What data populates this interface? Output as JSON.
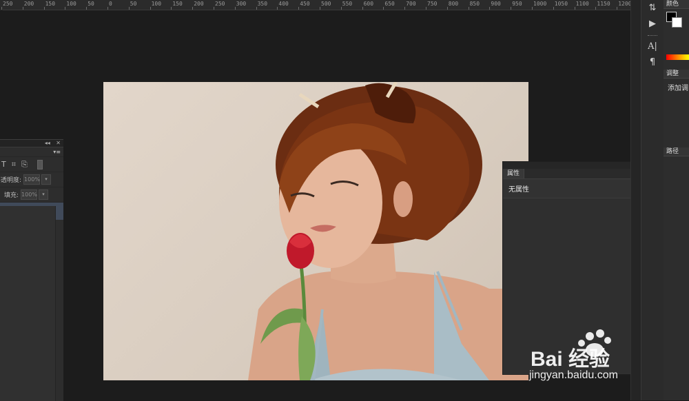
{
  "ruler": {
    "ticks": [
      "250",
      "200",
      "150",
      "100",
      "50",
      "0",
      "50",
      "100",
      "150",
      "200",
      "250",
      "300",
      "350",
      "400",
      "450",
      "500",
      "550",
      "600",
      "650",
      "700",
      "750",
      "800",
      "850",
      "900",
      "950",
      "1000",
      "1050",
      "1100",
      "1150",
      "1200"
    ]
  },
  "layers_panel": {
    "opacity_label": "不透明度:",
    "opacity_value": "100%",
    "fill_label": "填充:",
    "fill_value": "100%"
  },
  "properties_panel": {
    "tab_label": "属性",
    "body_text": "无属性"
  },
  "right_panels": {
    "color_tab": "颜色",
    "adjust_tab": "调整",
    "add_adjust": "添加调",
    "paths_tab": "路径"
  },
  "watermark": {
    "brand": "Bai 经验",
    "url": "jingyan.baidu.com"
  },
  "colors": {
    "app_bg": "#1a1a1a",
    "panel_bg": "#2d2d2d",
    "selected_layer": "#404a5a",
    "photo_bg": "#ddd1c5"
  }
}
